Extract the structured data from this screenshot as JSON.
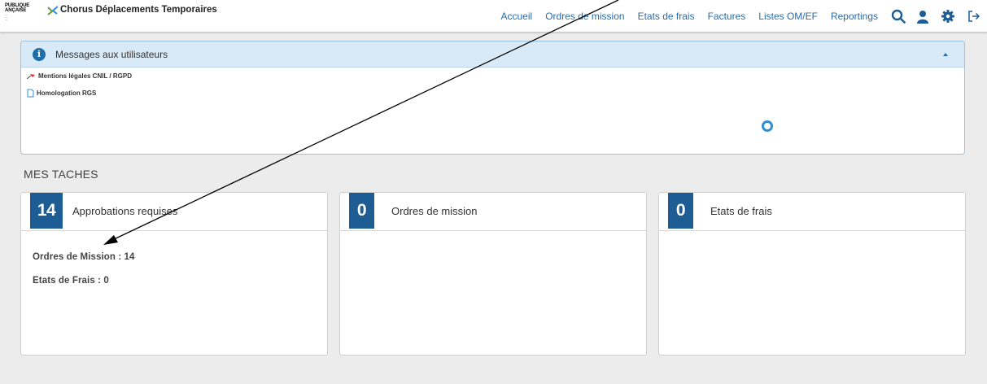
{
  "brand": {
    "marianne_line1": "PUBLIQUE",
    "marianne_line2": "ANÇAISE",
    "app_title": "Chorus Déplacements Temporaires"
  },
  "nav": {
    "links": [
      "Accueil",
      "Ordres de mission",
      "Etats de frais",
      "Factures",
      "Listes OM/EF",
      "Reportings"
    ],
    "icons": [
      "search-icon",
      "user-icon",
      "gear-icon",
      "logout-icon"
    ],
    "link_color": "#2b6aa8"
  },
  "messages": {
    "title": "Messages aux utilisateurs",
    "items": [
      {
        "label": "Mentions légales CNIL / RGPD",
        "icon": "pin-icon"
      },
      {
        "label": "Homologation RGS",
        "icon": "document-icon"
      }
    ]
  },
  "tasks": {
    "section_title": "MES TACHES",
    "cards": [
      {
        "count": "14",
        "label": "Approbations requises",
        "lines": [
          "Ordres de Mission : 14",
          "Etats de Frais : 0"
        ]
      },
      {
        "count": "0",
        "label": "Ordres de mission",
        "lines": []
      },
      {
        "count": "0",
        "label": "Etats de frais",
        "lines": []
      }
    ],
    "accent": "#1e5d94"
  }
}
